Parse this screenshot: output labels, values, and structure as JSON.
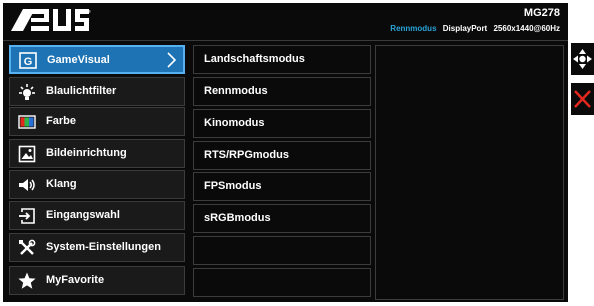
{
  "header": {
    "logo_text": "/ISUS",
    "model": "MG278",
    "mode": "Rennmodus",
    "port": "DisplayPort",
    "resolution": "2560x1440@60Hz"
  },
  "main_menu": {
    "items": [
      {
        "label": "GameVisual",
        "icon": "gamevisual-icon",
        "selected": true
      },
      {
        "label": "Blaulichtfilter",
        "icon": "blue-light-filter-icon"
      },
      {
        "label": "Farbe",
        "icon": "color-icon"
      },
      {
        "label": "Bildeinrichtung",
        "icon": "image-setup-icon"
      },
      {
        "label": "Klang",
        "icon": "speaker-icon"
      },
      {
        "label": "Eingangswahl",
        "icon": "input-select-icon"
      },
      {
        "label": "System-Einstellungen",
        "icon": "tools-icon"
      },
      {
        "label": "MyFavorite",
        "icon": "star-icon"
      }
    ]
  },
  "sub_menu": {
    "items": [
      {
        "label": "Landschaftsmodus"
      },
      {
        "label": "Rennmodus"
      },
      {
        "label": "Kinomodus"
      },
      {
        "label": "RTS/RPGmodus"
      },
      {
        "label": "FPSmodus"
      },
      {
        "label": "sRGBmodus"
      },
      {
        "label": ""
      },
      {
        "label": ""
      }
    ]
  },
  "side_keys": [
    {
      "icon": "move-arrows-icon"
    },
    {
      "icon": "close-icon"
    }
  ],
  "colors": {
    "accent": "#1d73b3",
    "accent_border": "#57b0f0",
    "mode_text": "#2aa3d8",
    "close": "#e5281e",
    "background": "#0a0a0a"
  }
}
